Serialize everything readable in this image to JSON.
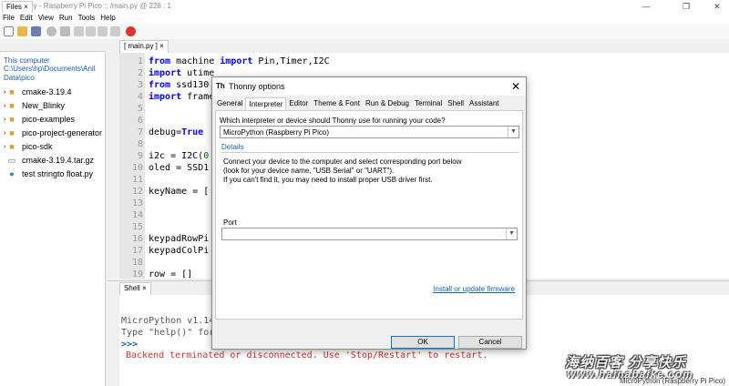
{
  "window": {
    "title": "Thonny  -  Raspberry Pi Pico :: /main.py  @  228 : 1",
    "app_icon": "Th"
  },
  "menu": [
    "File",
    "Edit",
    "View",
    "Run",
    "Tools",
    "Help"
  ],
  "files": {
    "tab_label": "Files  ×",
    "section_title": "This computer",
    "path": "C:\\Users\\hp\\Documents\\Anil Data\\pico",
    "items": [
      {
        "label": "cmake-3.19.4",
        "type": "folder"
      },
      {
        "label": "New_Blinky",
        "type": "folder"
      },
      {
        "label": "pico-examples",
        "type": "folder"
      },
      {
        "label": "pico-project-generator",
        "type": "folder"
      },
      {
        "label": "pico-sdk",
        "type": "folder"
      },
      {
        "label": "cmake-3.19.4.tar.gz",
        "type": "file"
      },
      {
        "label": "test stringto float.py",
        "type": "python"
      }
    ]
  },
  "editor": {
    "tab_label": "[ main.py ]  ×",
    "line_numbers": [
      "1",
      "2",
      "3",
      "4",
      "5",
      "6",
      "7",
      "8",
      "9",
      "10",
      "11",
      "12",
      "13",
      "14",
      "15",
      "16",
      "17",
      "18",
      "19"
    ]
  },
  "shell": {
    "tab_label": "Shell  ×",
    "line1": "MicroPython v1.14",
    "line2": "Type \"help()\" for",
    "prompt": ">>>",
    "error": "Backend terminated or disconnected. Use 'Stop/Restart' to restart."
  },
  "status": {
    "interpreter": "MicroPython (Raspberry Pi Pico)"
  },
  "watermark": {
    "text": "海纳百客 分享快乐",
    "url": "www.hainabaike.com"
  },
  "dialog": {
    "title": "Thonny options",
    "tabs": [
      "General",
      "Interpreter",
      "Editor",
      "Theme & Font",
      "Run & Debug",
      "Terminal",
      "Shell",
      "Assistant"
    ],
    "question": "Which interpreter or device should Thonny use for running your code?",
    "interpreter_value": "MicroPython (Raspberry Pi Pico)",
    "details_label": "Details",
    "info1": "Connect your device to the computer and select corresponding port below",
    "info2": "(look for your device name, \"USB Serial\" or \"UART\").",
    "info3": "If you can't find it, you may need to install proper USB driver first.",
    "port_label": "Port",
    "port_value": "",
    "install_link": "Install or update firmware",
    "ok_label": "OK",
    "cancel_label": "Cancel"
  },
  "colors": {
    "accent": "#0078d7",
    "link": "#1a5fb4",
    "keyword": "#0000ff",
    "error": "#cc3333"
  }
}
